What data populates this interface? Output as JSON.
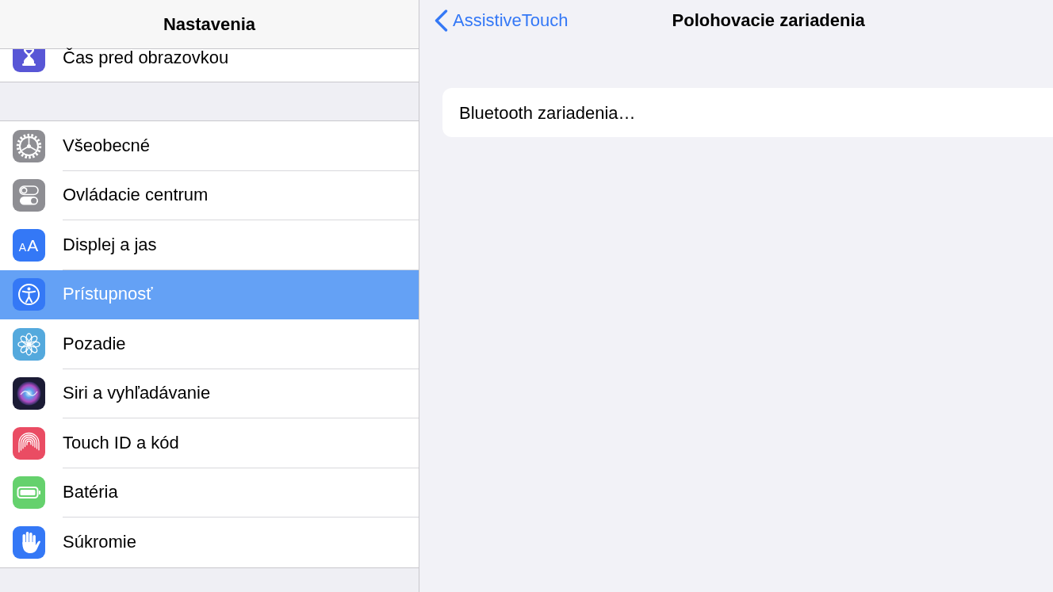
{
  "sidebar": {
    "title": "Nastavenia",
    "groups": [
      {
        "items": [
          {
            "label": "Čas pred obrazovkou",
            "selected": false
          }
        ]
      },
      {
        "items": [
          {
            "label": "Všeobecné",
            "selected": false
          },
          {
            "label": "Ovládacie centrum",
            "selected": false
          },
          {
            "label": "Displej a jas",
            "icon_text": "AA",
            "selected": false
          },
          {
            "label": "Prístupnosť",
            "selected": true
          },
          {
            "label": "Pozadie",
            "selected": false
          },
          {
            "label": "Siri a vyhľadávanie",
            "selected": false
          },
          {
            "label": "Touch ID a kód",
            "selected": false
          },
          {
            "label": "Batéria",
            "selected": false
          },
          {
            "label": "Súkromie",
            "selected": false
          }
        ]
      }
    ]
  },
  "detail": {
    "back_button": "AssistiveTouch",
    "title": "Polohovacie zariadenia",
    "items": [
      {
        "label": "Bluetooth zariadenia…"
      }
    ]
  }
}
